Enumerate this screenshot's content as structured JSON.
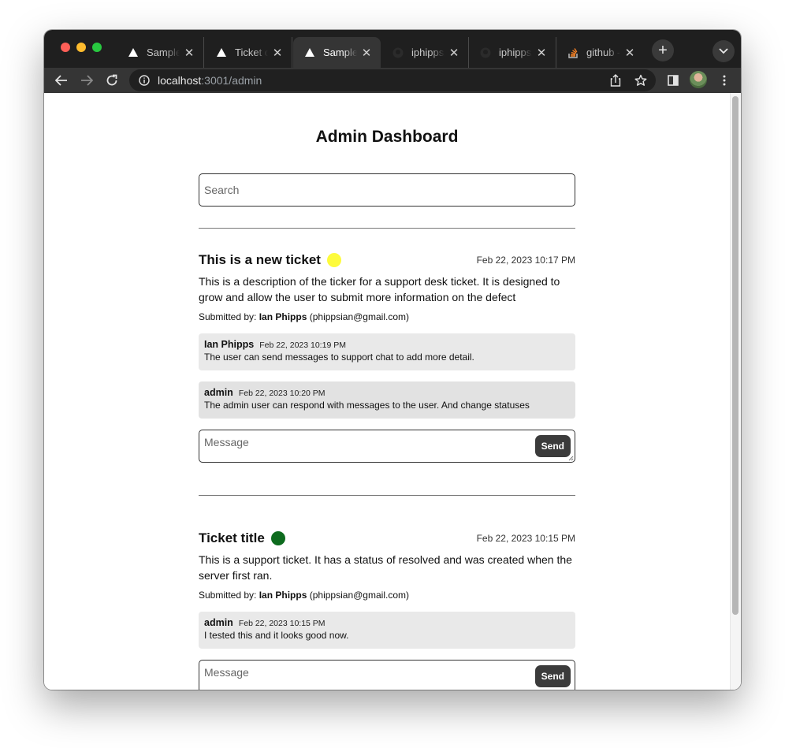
{
  "browser": {
    "tabs": [
      {
        "title": "Sample",
        "favicon": "vercel-triangle-icon",
        "active": false
      },
      {
        "title": "Ticket cl",
        "favicon": "vercel-triangle-icon",
        "active": false
      },
      {
        "title": "Sample",
        "favicon": "vercel-triangle-icon",
        "active": true
      },
      {
        "title": "iphipps/",
        "favicon": "github-icon",
        "active": false
      },
      {
        "title": "iphipps/",
        "favicon": "github-icon",
        "active": false
      },
      {
        "title": "github -",
        "favicon": "stackoverflow-icon",
        "active": false
      }
    ],
    "url_host": "localhost",
    "url_path": ":3001/admin"
  },
  "page": {
    "title": "Admin Dashboard",
    "search_placeholder": "Search",
    "message_placeholder": "Message",
    "send_label": "Send"
  },
  "tickets": [
    {
      "title": "This is a new ticket",
      "status_color": "#fdfb3c",
      "date": "Feb 22, 2023 10:17 PM",
      "description": "This is a description of the ticker for a support desk ticket. It is designed to grow and allow the user to submit more information on the defect",
      "submitted_prefix": "Submitted by:",
      "submitter_name": "Ian Phipps",
      "submitter_email": "(phippsian@gmail.com)",
      "messages": [
        {
          "author": "Ian Phipps",
          "date": "Feb 22, 2023 10:19 PM",
          "body": "The user can send messages to support chat to add more detail."
        },
        {
          "author": "admin",
          "date": "Feb 22, 2023 10:20 PM",
          "body": "The admin user can respond with messages to the user. And change statuses"
        }
      ]
    },
    {
      "title": "Ticket title",
      "status_color": "#0d6b1e",
      "date": "Feb 22, 2023 10:15 PM",
      "description": "This is a support ticket. It has a status of resolved and was created when the server first ran.",
      "submitted_prefix": "Submitted by:",
      "submitter_name": "Ian Phipps",
      "submitter_email": "(phippsian@gmail.com)",
      "messages": [
        {
          "author": "admin",
          "date": "Feb 22, 2023 10:15 PM",
          "body": "I tested this and it looks good now."
        }
      ]
    }
  ]
}
